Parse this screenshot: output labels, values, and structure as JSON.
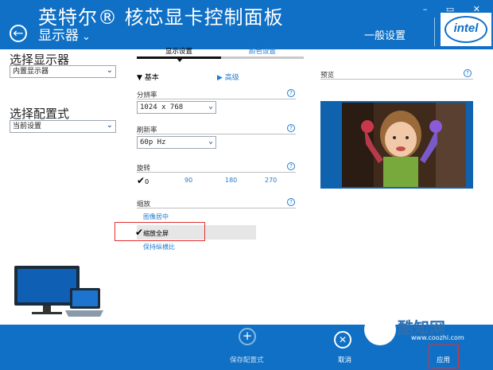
{
  "header": {
    "title": "英特尔® 核芯显卡控制面板",
    "menu_label": "显示器",
    "right_label": "一般设置",
    "brand": "intel",
    "window_buttons": "– ▭ ✕"
  },
  "left_panel": {
    "display_heading": "选择显示器",
    "display_value": "内置显示器",
    "profile_heading": "选择配置式",
    "profile_value": "当前设置"
  },
  "tabs": [
    {
      "label": "显示设置",
      "active": true
    },
    {
      "label": "颜色设置",
      "active": false
    }
  ],
  "mode_toggle": {
    "basic": "基本",
    "advanced": "高级"
  },
  "resolution": {
    "label": "分辨率",
    "value": "1024 x 768"
  },
  "refresh_rate": {
    "label": "刷新率",
    "value": "60p Hz"
  },
  "rotation": {
    "label": "旋转",
    "options": [
      "0",
      "90",
      "180",
      "270"
    ],
    "selected": "0"
  },
  "scaling": {
    "label": "缩放",
    "options": [
      "图像居中",
      "缩放全屏",
      "保持纵横比"
    ],
    "selected": "缩放全屏"
  },
  "preview": {
    "label": "预览"
  },
  "footer": {
    "save_profile": "保存配置式",
    "cancel": "取消",
    "apply": "应用"
  },
  "watermark": {
    "name": "酷知网",
    "url": "www.coozhi.com"
  },
  "colors": {
    "brand_blue": "#0f70c6",
    "link_blue": "#1f7bd1",
    "highlight_red": "#e53030"
  }
}
